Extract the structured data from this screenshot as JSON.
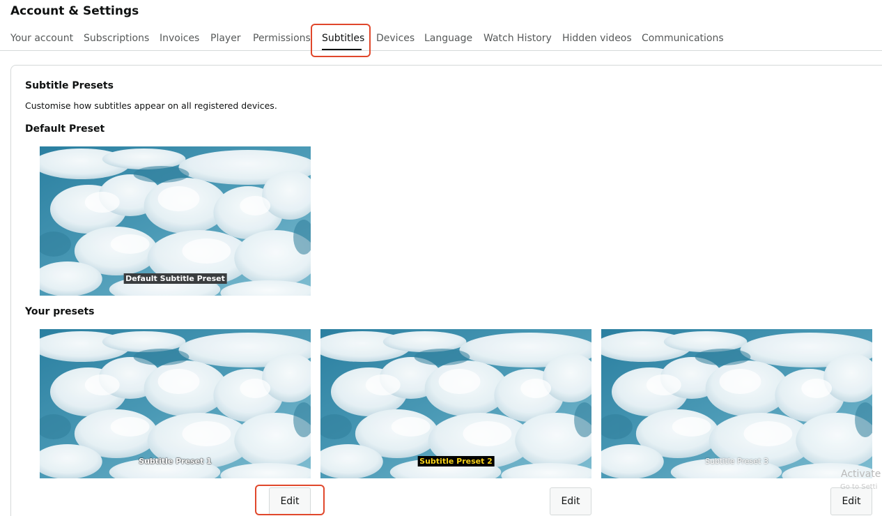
{
  "page": {
    "title": "Account & Settings"
  },
  "tabs": [
    {
      "label": "Your account"
    },
    {
      "label": "Subscriptions"
    },
    {
      "label": "Invoices"
    },
    {
      "label": "Player"
    },
    {
      "label": "Permissions"
    },
    {
      "label": "Subtitles",
      "active": true
    },
    {
      "label": "Devices"
    },
    {
      "label": "Language"
    },
    {
      "label": "Watch History"
    },
    {
      "label": "Hidden videos"
    },
    {
      "label": "Communications"
    }
  ],
  "subtitles": {
    "heading": "Subtitle Presets",
    "description": "Customise how subtitles appear on all registered devices.",
    "default_heading": "Default Preset",
    "default_caption": "Default Subtitle Preset",
    "your_presets_heading": "Your presets",
    "presets": [
      {
        "caption": "Subtitle Preset 1",
        "edit_label": "Edit"
      },
      {
        "caption": "Subtitle Preset 2",
        "edit_label": "Edit"
      },
      {
        "caption": "Subtitle Preset 3",
        "edit_label": "Edit"
      }
    ]
  },
  "overlay": {
    "activate_text": "Activate",
    "activate_sub": "Go to Setti"
  },
  "colors": {
    "sky_light": "#8cc3d6",
    "sky_dark": "#1e6f8f",
    "highlight": "#e0472b",
    "preset2_caption_bg": "#000000",
    "preset2_caption_fg": "#f7d117"
  }
}
